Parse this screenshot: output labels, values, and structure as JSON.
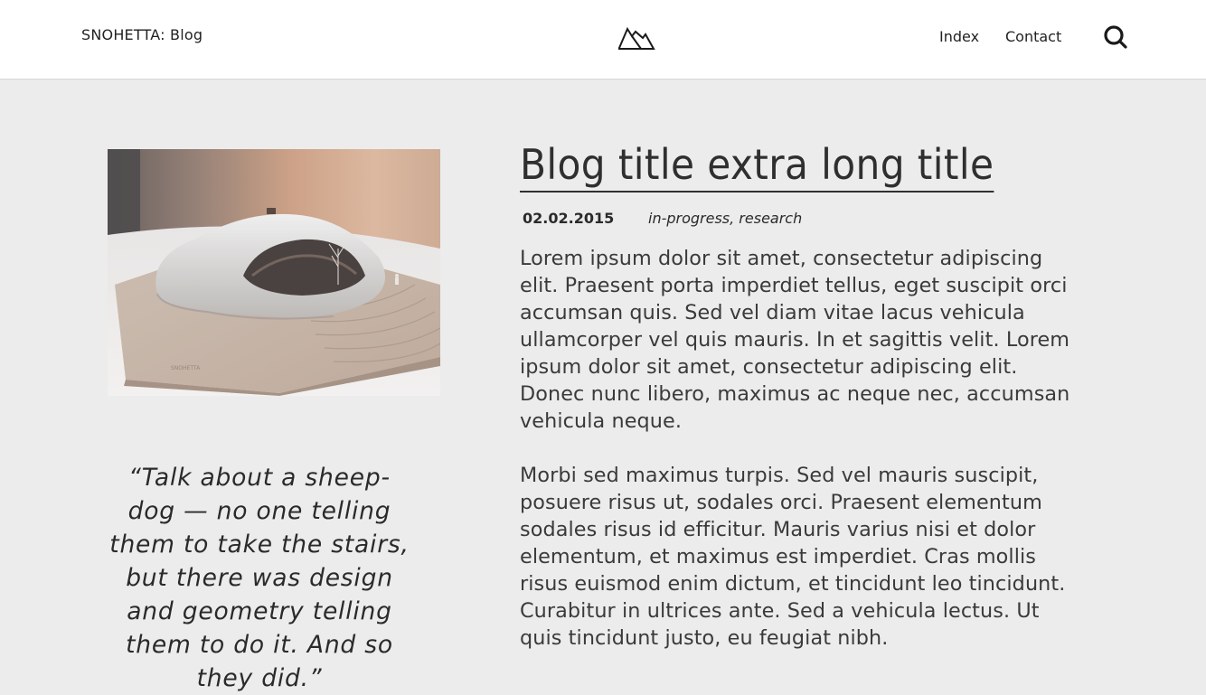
{
  "header": {
    "brand": "SNOHETTA: Blog",
    "logo_icon": "mountain-logo-icon",
    "nav": [
      {
        "label": "Index"
      },
      {
        "label": "Contact"
      }
    ],
    "search_icon": "search-icon"
  },
  "sidebar": {
    "image": {
      "subject": "white sculptural architecture model with interior space on wooden base"
    },
    "quote": "“Talk about a sheep-dog — no one telling them to take the stairs, but there was design and geometry telling them to do it. And so they did.”"
  },
  "post": {
    "title": "Blog title extra long title",
    "date": "02.02.2015",
    "tags": "in-progress, research",
    "paragraphs": [
      "Lorem ipsum dolor sit amet, consectetur adipiscing elit. Praesent porta imperdiet tellus, eget suscipit orci accumsan quis. Sed vel diam vitae lacus vehicula ullamcorper vel quis mauris. In et sagittis velit. Lorem ipsum dolor sit amet, consectetur adipiscing elit. Donec nunc libero, maximus ac neque nec, accumsan vehicula neque.",
      "Morbi sed maximus turpis. Sed vel mauris suscipit, posuere risus ut, sodales orci. Praesent elementum sodales risus id efficitur. Mauris varius nisi et dolor elementum, et maximus est imperdiet. Cras mollis risus euismod enim dictum, et tincidunt leo tincidunt. Curabitur in ultrices ante. Sed a vehicula lectus. Ut quis tincidunt justo, eu feugiat nibh."
    ]
  },
  "colors": {
    "background": "#ececec",
    "header_background": "#ffffff",
    "text": "#2b2b2b"
  }
}
